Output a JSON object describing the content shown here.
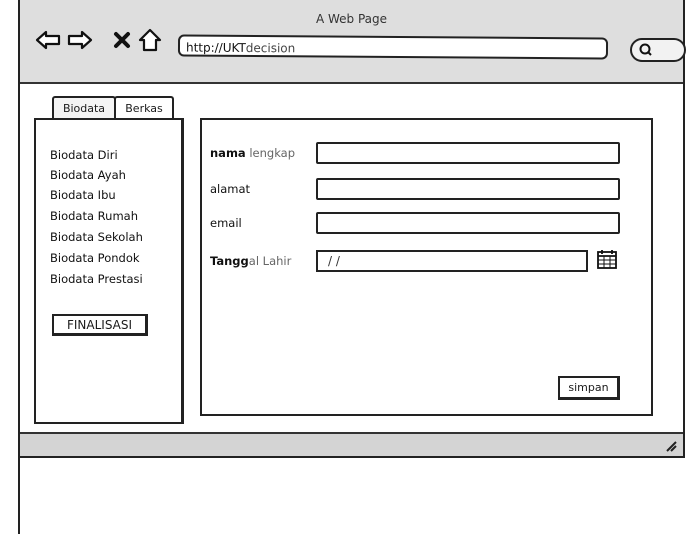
{
  "window": {
    "title": "A Web Page",
    "url_protocol": "http://UKT",
    "url_rest": "decision"
  },
  "nav_icons": [
    "back-arrow-icon",
    "forward-arrow-icon",
    "close-x-icon",
    "home-icon",
    "search-icon"
  ],
  "tabs": [
    {
      "label": "Biodata"
    },
    {
      "label": "Berkas"
    }
  ],
  "sidebar": {
    "items": [
      {
        "label": "Biodata Diri"
      },
      {
        "label": "Biodata Ayah"
      },
      {
        "label": "Biodata Ibu"
      },
      {
        "label": "Biodata Rumah"
      },
      {
        "label": "Biodata Sekolah"
      },
      {
        "label": "Biodata Pondok"
      },
      {
        "label": "Biodata Prestasi"
      }
    ],
    "finalize_label": "FINALISASI"
  },
  "form": {
    "fields": [
      {
        "label_bold": "nama",
        "label_light": " lengkap",
        "value": ""
      },
      {
        "label_bold": "alamat",
        "label_light": "",
        "value": ""
      },
      {
        "label_bold": "email",
        "label_light": "",
        "value": ""
      }
    ],
    "date_label_bold": "Tangg",
    "date_label_light": "al Lahir",
    "date_value": "/ /",
    "save_label": "simpan"
  }
}
